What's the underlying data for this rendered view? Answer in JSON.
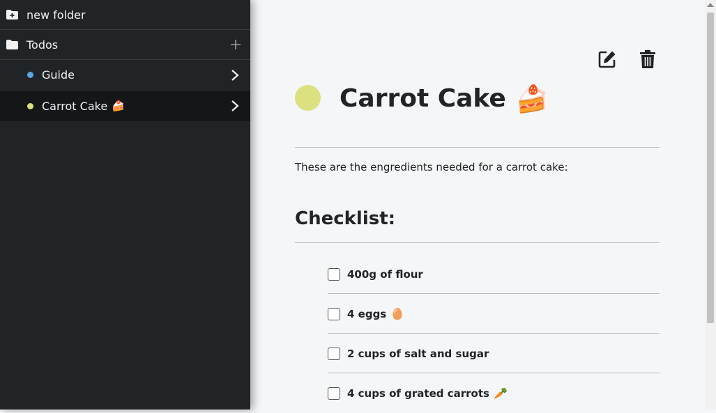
{
  "sidebar": {
    "new_folder": {
      "label": "new folder",
      "icon": "folder-plus-icon"
    },
    "folders": [
      {
        "label": "Todos",
        "icon": "folder-icon",
        "action_icon": "plus-icon"
      }
    ],
    "notes": [
      {
        "label": "Guide",
        "dot_color": "#5aa7e0",
        "icon": "chevron-right-icon",
        "active": false
      },
      {
        "label": "Carrot Cake",
        "emoji": "🍰",
        "dot_color": "#dbe17e",
        "icon": "chevron-right-icon",
        "active": true
      }
    ]
  },
  "note": {
    "color": "#dbe17e",
    "title": "Carrot Cake",
    "title_emoji": "🍰",
    "description": "These are the engredients needed for a carrot cake:",
    "checklist_title": "Checklist:",
    "toolbar": {
      "edit_icon": "edit-icon",
      "delete_icon": "trash-icon"
    },
    "items": [
      {
        "text": "400g of flour",
        "emoji": "",
        "checked": false
      },
      {
        "text": "4 eggs",
        "emoji": "🥚",
        "checked": false
      },
      {
        "text": "2 cups of salt and sugar",
        "emoji": "",
        "checked": false
      },
      {
        "text": "4 cups of grated carrots",
        "emoji": "🥕",
        "checked": false
      }
    ]
  }
}
